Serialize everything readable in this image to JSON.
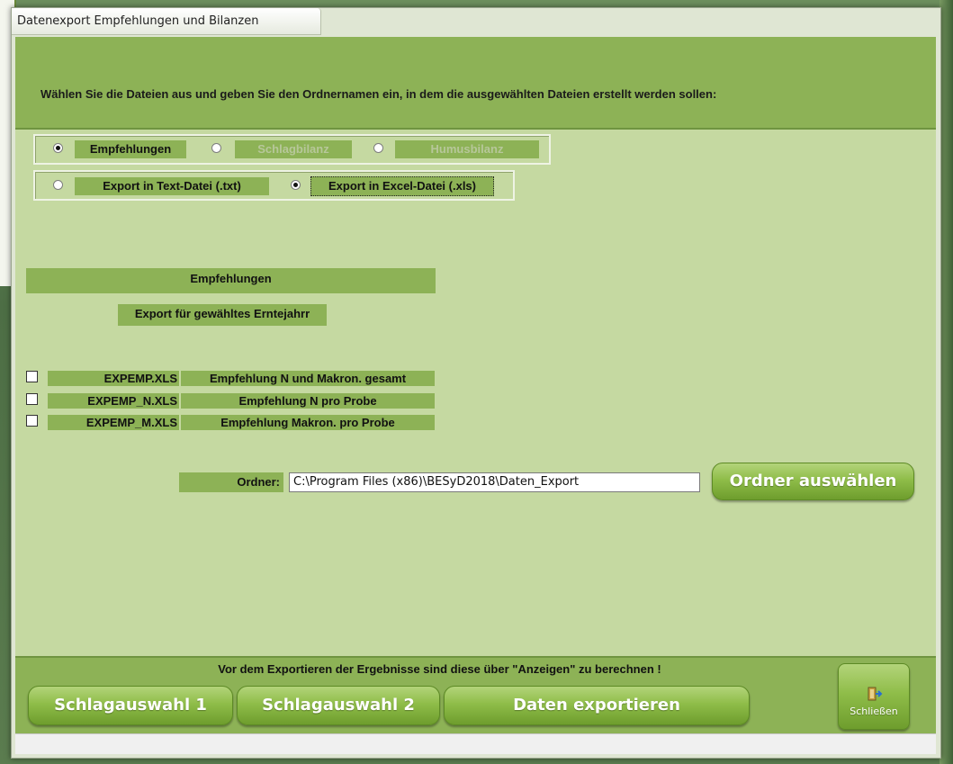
{
  "window": {
    "title": "Datenexport Empfehlungen und Bilanzen"
  },
  "header": {
    "instruction": "Wählen Sie die Dateien aus und geben Sie den Ordnernamen ein, in dem die ausgewählten Dateien erstellt werden sollen:"
  },
  "type_options": [
    {
      "label": "Empfehlungen",
      "selected": true,
      "enabled": true
    },
    {
      "label": "Schlagbilanz",
      "selected": false,
      "enabled": false
    },
    {
      "label": "Humusbilanz",
      "selected": false,
      "enabled": false
    }
  ],
  "format_options": [
    {
      "label": "Export in Text-Datei (.txt)",
      "selected": false
    },
    {
      "label": "Export in Excel-Datei (.xls)",
      "selected": true
    }
  ],
  "section": {
    "title": "Empfehlungen",
    "subtitle": "Export für gewähltes Erntejahrr"
  },
  "files": [
    {
      "name": "EXPEMP.XLS",
      "description": "Empfehlung N und Makron. gesamt",
      "checked": false
    },
    {
      "name": "EXPEMP_N.XLS",
      "description": "Empfehlung N pro Probe",
      "checked": false
    },
    {
      "name": "EXPEMP_M.XLS",
      "description": "Empfehlung Makron. pro Probe",
      "checked": false
    }
  ],
  "folder": {
    "label": "Ordner:",
    "value": "C:\\Program Files (x86)\\BESyD2018\\Daten_Export",
    "choose_button": "Ordner auswählen"
  },
  "footer": {
    "note": "Vor dem Exportieren der Ergebnisse sind diese über \"Anzeigen\" zu berechnen !",
    "btn_schlag1": "Schlagauswahl 1",
    "btn_schlag2": "Schlagauswahl 2",
    "btn_export": "Daten exportieren",
    "btn_close": "Schließen"
  },
  "colors": {
    "accent": "#8db256",
    "client_bg": "#c5d9a1",
    "button": "#8fbd49"
  },
  "icons": {
    "close": "exit-door-icon"
  }
}
